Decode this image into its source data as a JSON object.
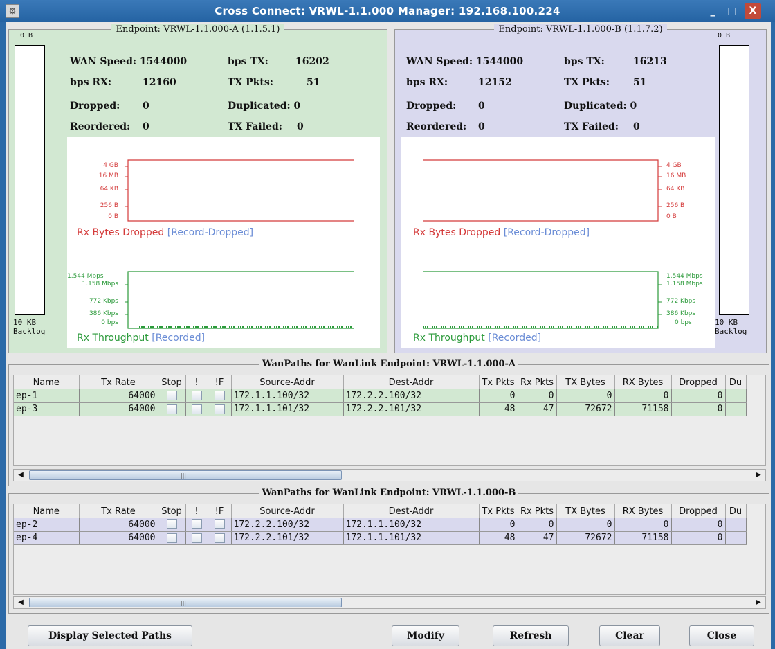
{
  "window": {
    "title": "Cross Connect: VRWL-1.1.000  Manager: 192.168.100.224",
    "minimize": "_",
    "maximize": "□",
    "close": "X"
  },
  "endpoint_a": {
    "title": "Endpoint: VRWL-1.1.000-A  (1.1.5.1)",
    "backlog_top": "0 B",
    "backlog_bottom_1": "10 KB",
    "backlog_bottom_2": "Backlog",
    "wan_speed_label": "WAN Speed:",
    "wan_speed": "1544000",
    "bps_tx_label": "bps TX:",
    "bps_tx": "16202",
    "bps_rx_label": "bps RX:",
    "bps_rx": "12160",
    "tx_pkts_label": "TX Pkts:",
    "tx_pkts": "51",
    "dropped_label": "Dropped:",
    "dropped": "0",
    "duplicated_label": "Duplicated:",
    "duplicated": "0",
    "reordered_label": "Reordered:",
    "reordered": "0",
    "tx_failed_label": "TX Failed:",
    "tx_failed": "0",
    "drop_axis": [
      "4 GB",
      "16 MB",
      "64 KB",
      "256 B",
      "0 B"
    ],
    "drop_title": "Rx Bytes Dropped",
    "drop_record": "[Record-Dropped]",
    "tput_axis": [
      "1.544 Mbps",
      "1.158 Mbps",
      "772 Kbps",
      "386 Kbps",
      "0 bps"
    ],
    "tput_title": "Rx Throughput",
    "tput_record": "[Recorded]"
  },
  "endpoint_b": {
    "title": "Endpoint: VRWL-1.1.000-B  (1.1.7.2)",
    "backlog_top": "0 B",
    "backlog_bottom_1": "10 KB",
    "backlog_bottom_2": "Backlog",
    "wan_speed_label": "WAN Speed:",
    "wan_speed": "1544000",
    "bps_tx_label": "bps TX:",
    "bps_tx": "16213",
    "bps_rx_label": "bps RX:",
    "bps_rx": "12152",
    "tx_pkts_label": "TX Pkts:",
    "tx_pkts": "51",
    "dropped_label": "Dropped:",
    "dropped": "0",
    "duplicated_label": "Duplicated:",
    "duplicated": "0",
    "reordered_label": "Reordered:",
    "reordered": "0",
    "tx_failed_label": "TX Failed:",
    "tx_failed": "0",
    "drop_axis": [
      "4 GB",
      "16 MB",
      "64 KB",
      "256 B",
      "0 B"
    ],
    "drop_title": "Rx Bytes Dropped",
    "drop_record": "[Record-Dropped]",
    "tput_axis": [
      "1.544 Mbps",
      "1.158 Mbps",
      "772 Kbps",
      "386 Kbps",
      "0 bps"
    ],
    "tput_title": "Rx Throughput",
    "tput_record": "[Recorded]"
  },
  "columns": [
    "Name",
    "Tx Rate",
    "Stop",
    "!",
    "!F",
    "Source-Addr",
    "Dest-Addr",
    "Tx Pkts",
    "Rx Pkts",
    "TX Bytes",
    "RX Bytes",
    "Dropped",
    "Du"
  ],
  "wanpaths_a": {
    "title": "WanPaths for WanLink Endpoint: VRWL-1.1.000-A",
    "rows": [
      {
        "name": "ep-1",
        "tx_rate": "64000",
        "source": "172.1.1.100/32",
        "dest": "172.2.2.100/32",
        "tx_pkts": "0",
        "rx_pkts": "0",
        "tx_bytes": "0",
        "rx_bytes": "0",
        "dropped": "0"
      },
      {
        "name": "ep-3",
        "tx_rate": "64000",
        "source": "172.1.1.101/32",
        "dest": "172.2.2.101/32",
        "tx_pkts": "48",
        "rx_pkts": "47",
        "tx_bytes": "72672",
        "rx_bytes": "71158",
        "dropped": "0"
      }
    ]
  },
  "wanpaths_b": {
    "title": "WanPaths for WanLink Endpoint: VRWL-1.1.000-B",
    "rows": [
      {
        "name": "ep-2",
        "tx_rate": "64000",
        "source": "172.2.2.100/32",
        "dest": "172.1.1.100/32",
        "tx_pkts": "0",
        "rx_pkts": "0",
        "tx_bytes": "0",
        "rx_bytes": "0",
        "dropped": "0"
      },
      {
        "name": "ep-4",
        "tx_rate": "64000",
        "source": "172.2.2.101/32",
        "dest": "172.1.1.101/32",
        "tx_pkts": "48",
        "rx_pkts": "47",
        "tx_bytes": "72672",
        "rx_bytes": "71158",
        "dropped": "0"
      }
    ]
  },
  "buttons": {
    "display_selected": "Display Selected Paths",
    "modify": "Modify",
    "refresh": "Refresh",
    "clear": "Clear",
    "close": "Close"
  },
  "colors": {
    "panel_a": "#d2e8d2",
    "panel_b": "#d9d9ee",
    "dropped_series": "#d43a3a",
    "throughput_series": "#2b9a3a",
    "record_link": "#6b8dd6"
  }
}
